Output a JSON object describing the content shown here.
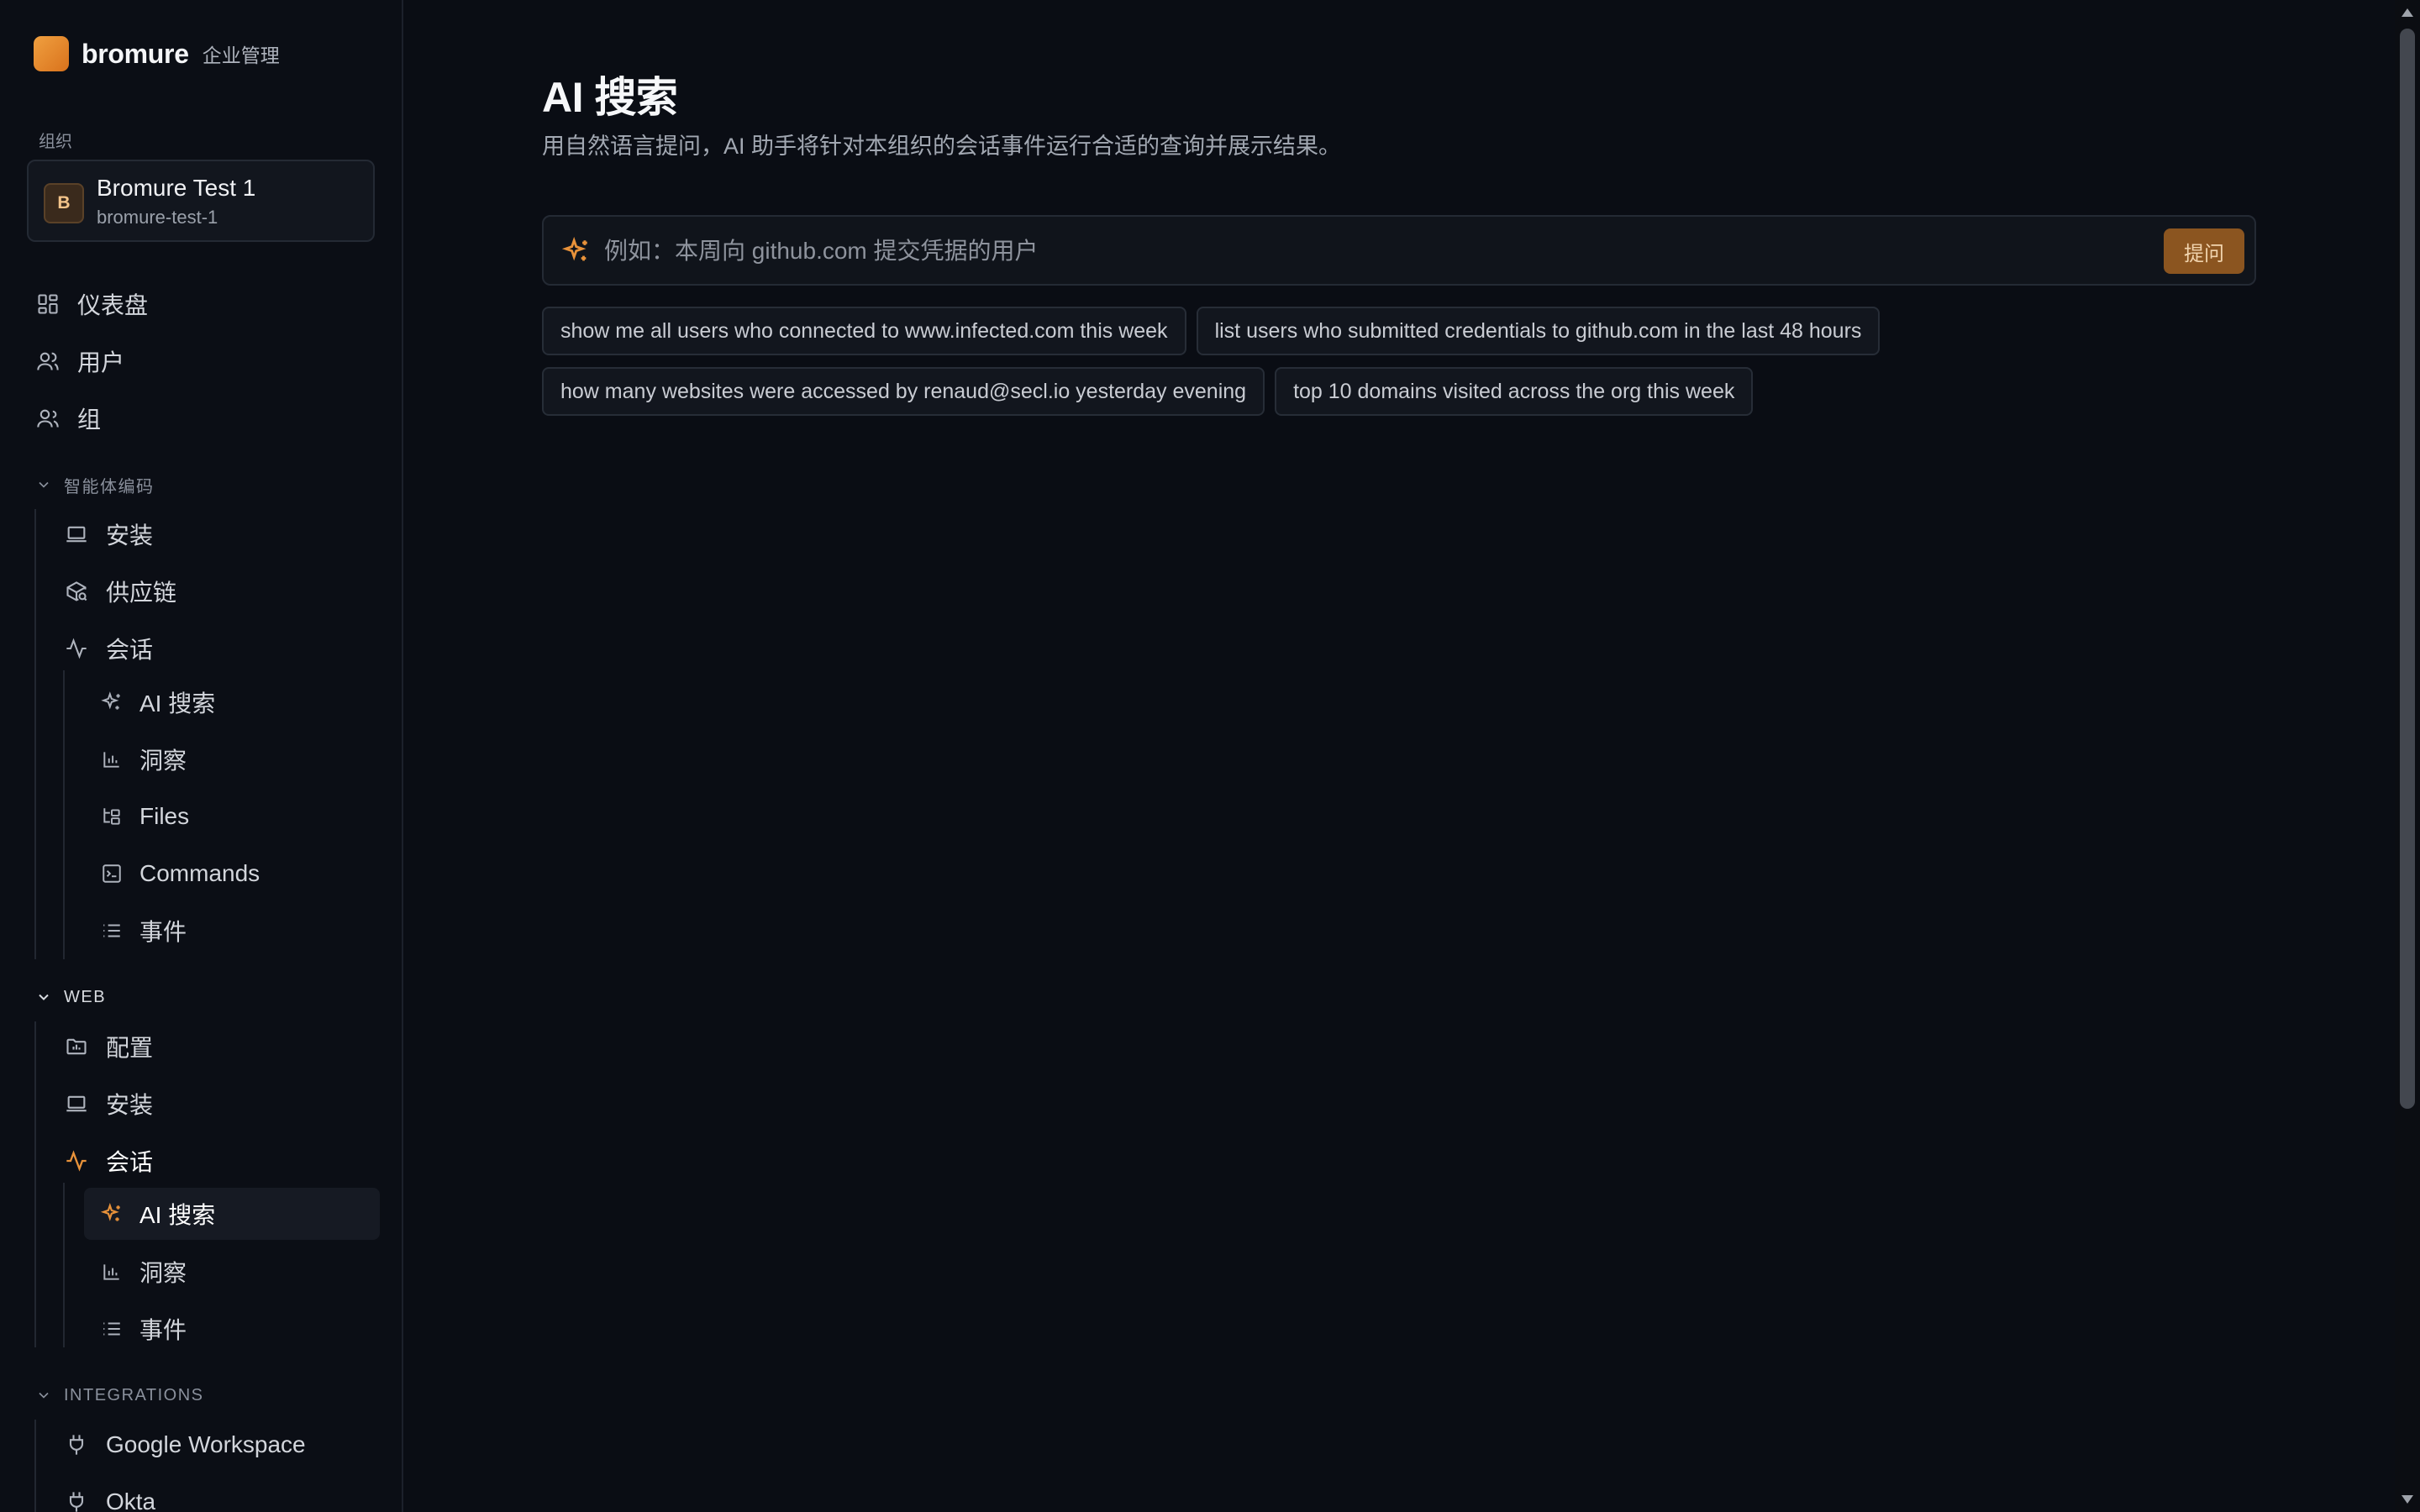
{
  "brand": {
    "name": "bromure",
    "subtitle": "企业管理"
  },
  "org": {
    "label": "组织",
    "avatar": "B",
    "name": "Bromure Test 1",
    "slug": "bromure-test-1"
  },
  "nav": {
    "dashboard": "仪表盘",
    "users": "用户",
    "groups": "组",
    "agent_section": "智能体编码",
    "agent": {
      "install": "安装",
      "supply_chain": "供应链",
      "sessions": "会话",
      "ai_search": "AI 搜索",
      "insights": "洞察",
      "files": "Files",
      "commands": "Commands",
      "events": "事件"
    },
    "web_section": "WEB",
    "web": {
      "config": "配置",
      "install": "安装",
      "sessions": "会话",
      "ai_search": "AI 搜索",
      "insights": "洞察",
      "events": "事件"
    },
    "integrations_section": "INTEGRATIONS",
    "integrations": {
      "google": "Google Workspace",
      "okta": "Okta"
    }
  },
  "main": {
    "title": "AI 搜索",
    "description": "用自然语言提问，AI 助手将针对本组织的会话事件运行合适的查询并展示结果。",
    "search": {
      "placeholder": "例如：本周向 github.com 提交凭据的用户",
      "value": ""
    },
    "ask_button": "提问",
    "suggestions": [
      "show me all users who connected to www.infected.com this week",
      "list users who submitted credentials to github.com in the last 48 hours",
      "how many websites were accessed by renaud@secl.io yesterday evening",
      "top 10 domains visited across the org this week"
    ]
  },
  "colors": {
    "accent": "#e8923a",
    "background": "#0a0d14",
    "button": "#8b5520"
  }
}
